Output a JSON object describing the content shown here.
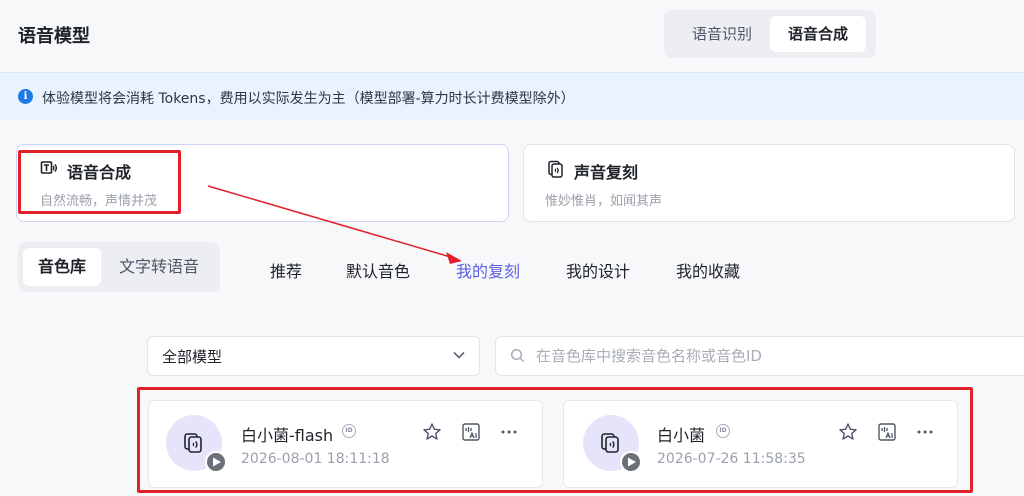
{
  "header": {
    "title": "语音模型",
    "tabs": [
      {
        "label": "语音识别",
        "active": false
      },
      {
        "label": "语音合成",
        "active": true
      }
    ]
  },
  "notice": {
    "icon": "info-icon",
    "text": "体验模型将会消耗 Tokens，费用以实际发生为主（模型部署-算力时长计费模型除外）"
  },
  "modes": [
    {
      "title": "语音合成",
      "subtitle": "自然流畅，声情并茂",
      "icon": "tts-icon",
      "selected": true
    },
    {
      "title": "声音复刻",
      "subtitle": "惟妙惟肖，如闻其声",
      "icon": "voice-clone-icon",
      "selected": false
    }
  ],
  "subtabs": [
    {
      "label": "音色库",
      "active": true
    },
    {
      "label": "文字转语音",
      "active": false
    }
  ],
  "categories": [
    {
      "label": "推荐",
      "active": false
    },
    {
      "label": "默认音色",
      "active": false
    },
    {
      "label": "我的复刻",
      "active": true
    },
    {
      "label": "我的设计",
      "active": false
    },
    {
      "label": "我的收藏",
      "active": false
    }
  ],
  "filter": {
    "model_select": "全部模型",
    "search_placeholder": "在音色库中搜索音色名称或音色ID"
  },
  "voices": [
    {
      "name": "白小菌-flash",
      "date": "2026-08-01 18:11:18",
      "id_badge": "ID"
    },
    {
      "name": "白小菌",
      "date": "2026-07-26 11:58:35",
      "id_badge": "ID"
    }
  ],
  "colors": {
    "accent": "#5b5fe6",
    "annotation_red": "#e0202a",
    "info_bg": "#e8f3fd"
  }
}
